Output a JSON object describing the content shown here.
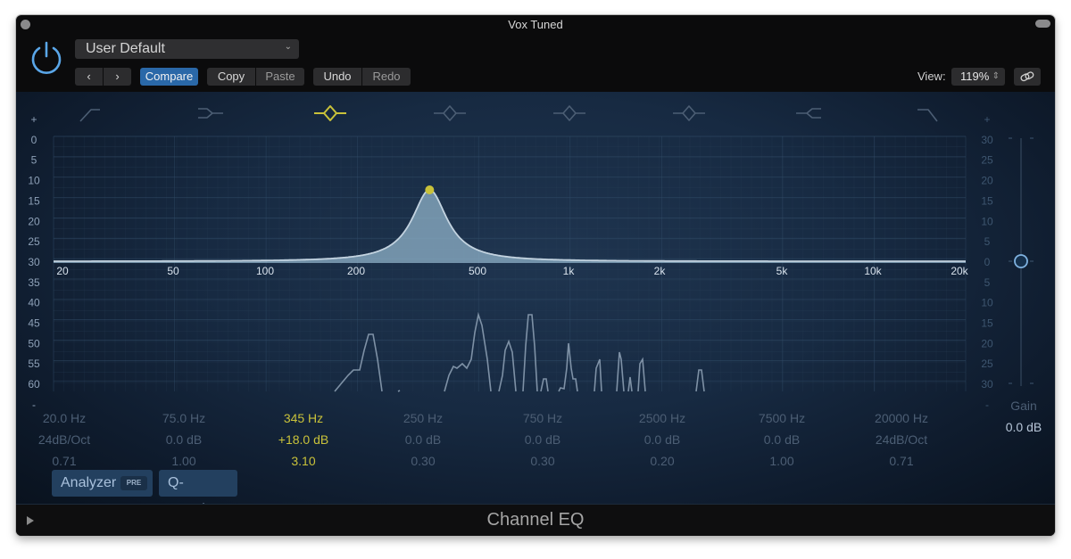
{
  "window": {
    "title": "Vox Tuned"
  },
  "header": {
    "preset": "User Default",
    "buttons": {
      "prev": "‹",
      "next": "›",
      "compare": "Compare",
      "copy": "Copy",
      "paste": "Paste",
      "undo": "Undo",
      "redo": "Redo"
    },
    "view_label": "View:",
    "view_value": "119%"
  },
  "graph": {
    "left_scale": [
      "+",
      "0",
      "5",
      "10",
      "15",
      "20",
      "25",
      "30",
      "35",
      "40",
      "45",
      "50",
      "55",
      "60",
      "-"
    ],
    "right_scale": [
      "+",
      "30",
      "25",
      "20",
      "15",
      "10",
      "5",
      "0",
      "5",
      "10",
      "15",
      "20",
      "25",
      "30",
      "-"
    ],
    "freq_labels": [
      "20",
      "50",
      "100",
      "200",
      "500",
      "1k",
      "2k",
      "5k",
      "10k",
      "20k"
    ],
    "band_icons": [
      "low-cut-icon",
      "low-shelf-icon",
      "bell-icon",
      "bell-icon",
      "bell-icon",
      "bell-icon",
      "high-shelf-icon",
      "high-cut-icon"
    ],
    "active_band": 2,
    "colors": {
      "active": "#c9c23a",
      "inactive": "#4c5e74",
      "curve_fill": "#8fb1c8",
      "accent_blue": "#5aa6e8"
    }
  },
  "bands": [
    {
      "freq": "20.0 Hz",
      "gain": "24dB/Oct",
      "q": "0.71"
    },
    {
      "freq": "75.0 Hz",
      "gain": "0.0 dB",
      "q": "1.00"
    },
    {
      "freq": "345 Hz",
      "gain": "+18.0 dB",
      "q": "3.10"
    },
    {
      "freq": "250 Hz",
      "gain": "0.0 dB",
      "q": "0.30"
    },
    {
      "freq": "750 Hz",
      "gain": "0.0 dB",
      "q": "0.30"
    },
    {
      "freq": "2500 Hz",
      "gain": "0.0 dB",
      "q": "0.20"
    },
    {
      "freq": "7500 Hz",
      "gain": "0.0 dB",
      "q": "1.00"
    },
    {
      "freq": "20000 Hz",
      "gain": "24dB/Oct",
      "q": "0.71"
    }
  ],
  "gain": {
    "label": "Gain",
    "value": "0.0 dB",
    "level_db": 0
  },
  "toggles": {
    "analyzer": "Analyzer",
    "analyzer_badge": "PRE",
    "q_couple": "Q-Couple"
  },
  "footer": {
    "plugin_name": "Channel EQ"
  }
}
